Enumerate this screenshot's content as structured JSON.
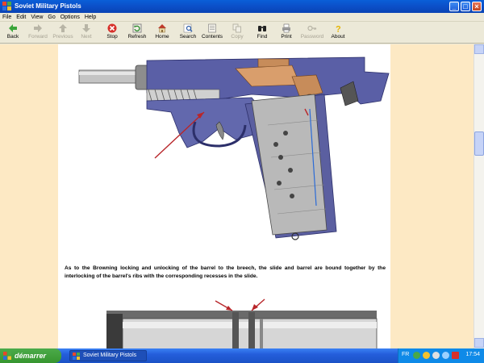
{
  "window": {
    "title": "Soviet Military Pistols"
  },
  "menu": [
    "File",
    "Edit",
    "View",
    "Go",
    "Options",
    "Help"
  ],
  "toolbar": {
    "back": "Back",
    "forward": "Forward",
    "previous": "Previous",
    "next": "Next",
    "stop": "Stop",
    "refresh": "Refresh",
    "home": "Home",
    "search": "Search",
    "contents": "Contents",
    "copy": "Copy",
    "find": "Find",
    "print": "Print",
    "password": "Password",
    "about": "About"
  },
  "content": {
    "caption": "As to the Browning locking and unlocking of the barrel to the breech, the slide and barrel are bound together by the interlocking of the barrel's ribs with the corresponding recesses in the slide."
  },
  "taskbar": {
    "start": "démarrer",
    "task": "Soviet Military Pistols",
    "lang": "FR",
    "clock": "17:54"
  },
  "colors": {
    "page_bg": "#fde9c4",
    "arrow": "#b8262a",
    "slide": "#5a5fa6"
  }
}
